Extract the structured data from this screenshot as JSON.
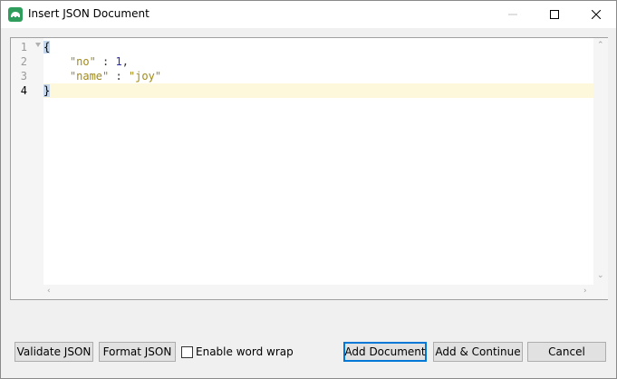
{
  "window": {
    "title": "Insert JSON Document",
    "controls": {
      "minimize": "minimize",
      "maximize": "maximize",
      "close": "close"
    }
  },
  "editor": {
    "line_numbers": [
      "1",
      "2",
      "3",
      "4"
    ],
    "active_line": 4,
    "lines": [
      {
        "open_brace": "{"
      },
      {
        "key": "\"no\"",
        "sep": " : ",
        "value": "1",
        "trail": ","
      },
      {
        "key": "\"name\"",
        "sep": " : ",
        "value": "\"joy\""
      },
      {
        "close_brace": "}"
      }
    ]
  },
  "footer": {
    "validate_label": "Validate JSON",
    "format_label": "Format JSON",
    "word_wrap_label": "Enable word wrap",
    "word_wrap_checked": false,
    "add_document_label": "Add Document",
    "add_continue_label": "Add & Continue",
    "cancel_label": "Cancel"
  },
  "icons": {
    "app": "studio-app-icon",
    "minimize": "minimize-icon",
    "maximize": "maximize-icon",
    "close": "close-icon"
  },
  "colors": {
    "accent": "#0078d7",
    "string": "#a08a1a",
    "number": "#2a2ab0",
    "current_line": "#fdf8dc",
    "brace_highlight": "#c6d6ea",
    "app_icon": "#2f9e5c"
  }
}
